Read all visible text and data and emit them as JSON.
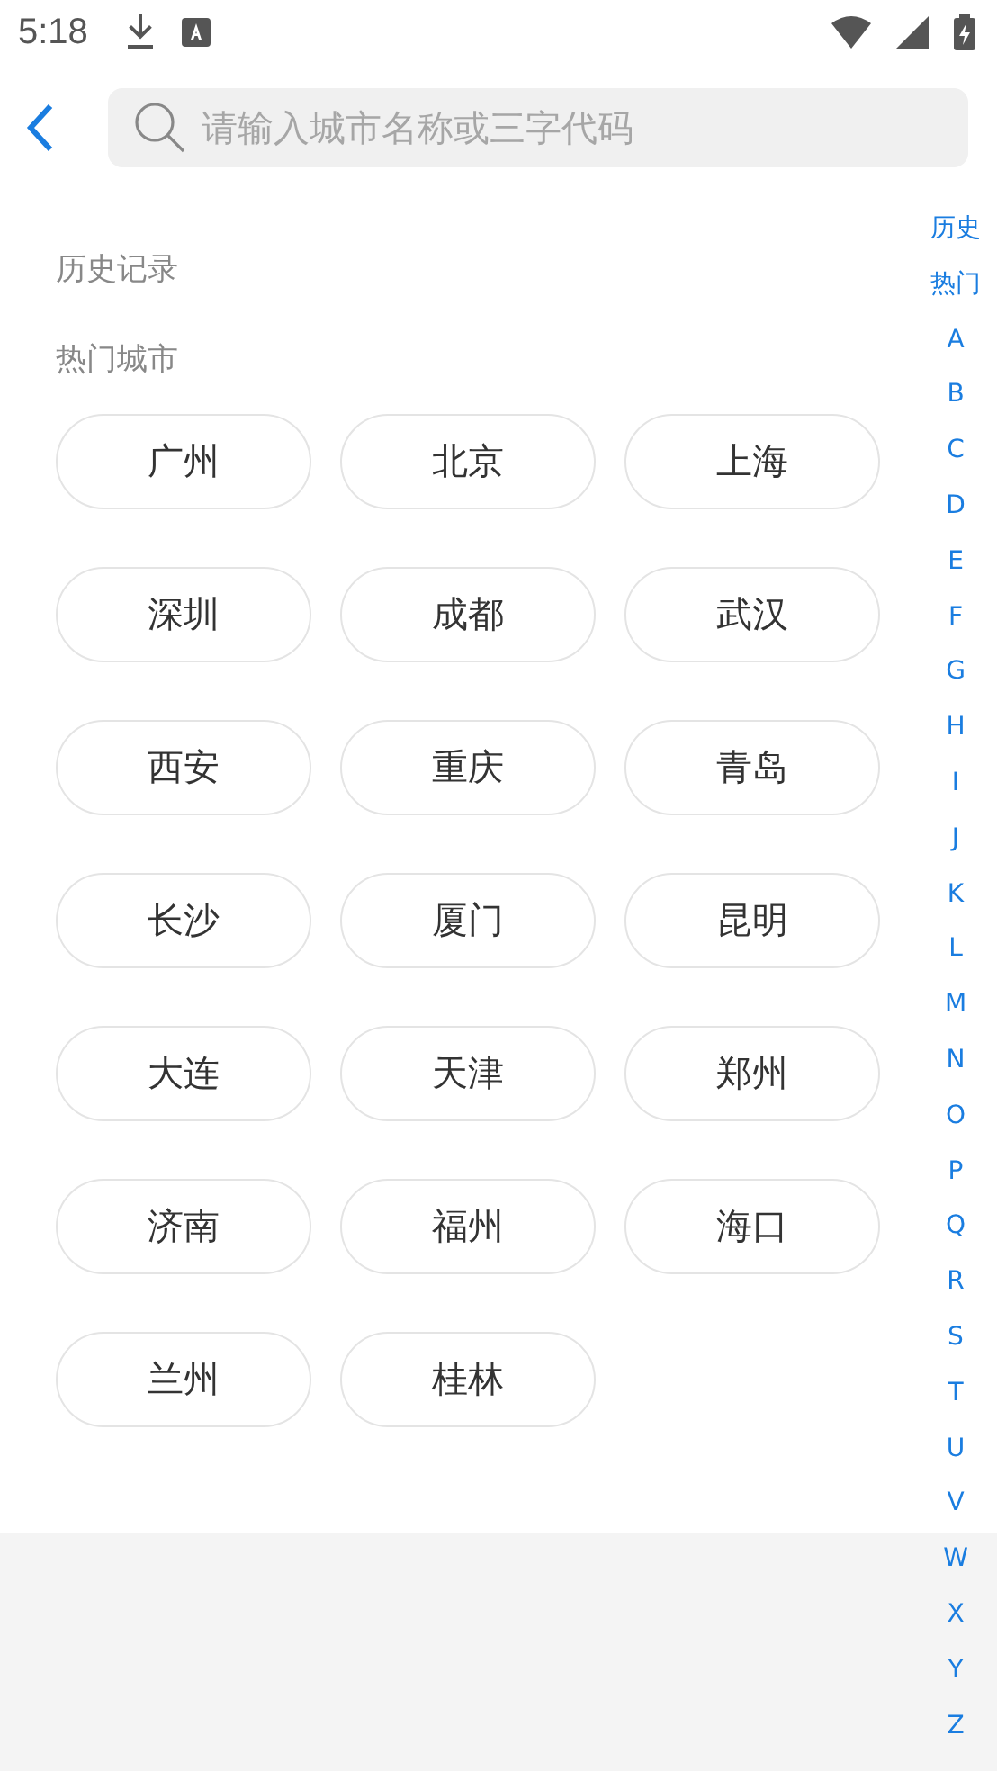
{
  "status_bar": {
    "time": "5:18"
  },
  "search": {
    "placeholder": "请输入城市名称或三字代码"
  },
  "history": {
    "title": "历史记录"
  },
  "hot_cities": {
    "title": "热门城市",
    "cities": [
      "广州",
      "北京",
      "上海",
      "深圳",
      "成都",
      "武汉",
      "西安",
      "重庆",
      "青岛",
      "长沙",
      "厦门",
      "昆明",
      "大连",
      "天津",
      "郑州",
      "济南",
      "福州",
      "海口",
      "兰州",
      "桂林"
    ]
  },
  "index_bar": [
    "历史",
    "热门",
    "A",
    "B",
    "C",
    "D",
    "E",
    "F",
    "G",
    "H",
    "I",
    "J",
    "K",
    "L",
    "M",
    "N",
    "O",
    "P",
    "Q",
    "R",
    "S",
    "T",
    "U",
    "V",
    "W",
    "X",
    "Y",
    "Z"
  ]
}
